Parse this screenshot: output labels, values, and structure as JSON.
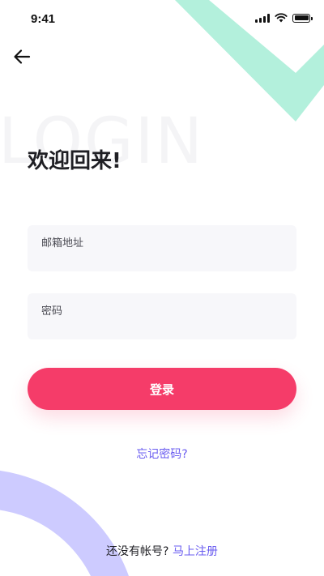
{
  "status_bar": {
    "time": "9:41",
    "icons": [
      "signal-icon",
      "wifi-icon",
      "battery-icon"
    ]
  },
  "header": {
    "back_icon": "arrow-left-icon"
  },
  "login": {
    "watermark": "LOGIN",
    "title": "欢迎回来!",
    "email_label": "邮箱地址",
    "email_value": "",
    "password_label": "密码",
    "password_value": "",
    "submit_label": "登录",
    "forgot_password": "忘记密码?",
    "no_account_text": "还没有帐号?",
    "register_link": "马上注册"
  },
  "colors": {
    "primary": "#f53c69",
    "link": "#6a5cf0",
    "decoration_mint": "#b3f0dc",
    "decoration_lavender": "#cdcbff",
    "field_background": "#f7f7fa"
  }
}
